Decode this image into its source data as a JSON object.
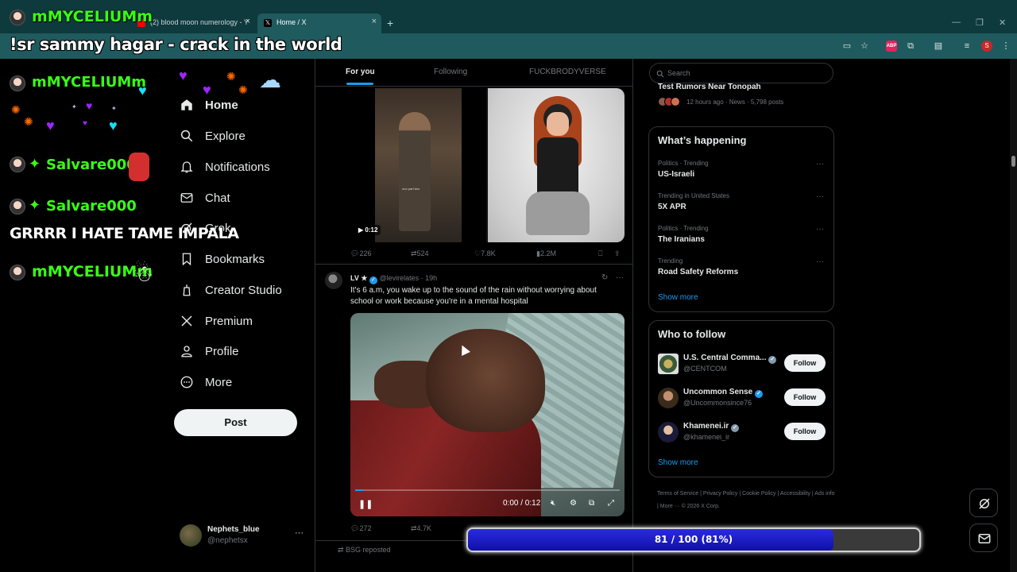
{
  "browser": {
    "tabs": [
      {
        "label": "(2) blood moon numerology - Y",
        "active": false
      },
      {
        "label": "Home / X",
        "active": true
      }
    ],
    "new_tab": "+",
    "tab_close": "×",
    "window": {
      "minimize": "—",
      "restore": "❐",
      "close": "✕"
    },
    "extensions": [
      "cast-icon",
      "star-icon",
      "abp-icon",
      "puzzle-icon",
      "sidebar-icon",
      "media-icon",
      "profile-icon",
      "menu-icon"
    ],
    "ext_abp_label": "ABP",
    "profile_initial": "S"
  },
  "overlay": {
    "song": "!sr sammy hagar - crack in the world",
    "names": [
      "mMYCELIUMm",
      "mMYCELIUMm",
      "Salvare000",
      "Salvare000",
      "mMYCELIUMm"
    ],
    "shout": "GRRRR I HATE TAME IMPALA",
    "progress": {
      "text": "81 / 100 (81%)",
      "value": 0.81
    }
  },
  "nav": {
    "items": [
      {
        "label": "Home",
        "icon": "home-icon"
      },
      {
        "label": "Explore",
        "icon": "search-icon"
      },
      {
        "label": "Notifications",
        "icon": "bell-icon"
      },
      {
        "label": "Chat",
        "icon": "mail-icon"
      },
      {
        "label": "Grok",
        "icon": "grok-icon"
      },
      {
        "label": "Bookmarks",
        "icon": "bookmark-icon"
      },
      {
        "label": "Creator Studio",
        "icon": "creator-studio-icon"
      },
      {
        "label": "Premium",
        "icon": "x-logo-icon"
      },
      {
        "label": "Profile",
        "icon": "person-icon"
      },
      {
        "label": "More",
        "icon": "more-circle-icon"
      }
    ],
    "post_label": "Post",
    "account": {
      "name": "Nephets_blue",
      "handle": "@nephetsx",
      "more": "···"
    }
  },
  "timeline": {
    "tabs": [
      "For you",
      "Following",
      "FUCKBRODYVERSE"
    ],
    "tweet1": {
      "video_duration": "0:12",
      "caption_in_video": "ooo part two",
      "replies": "226",
      "reposts": "524",
      "likes": "7.8K",
      "views": "2.2M"
    },
    "tweet2": {
      "name": "LV ★",
      "handle": "@levirelates",
      "time": "· 19h",
      "text": "It's 6 a.m, you wake up to the sound of the rain without worrying about school or work because you're in a mental hospital",
      "time_display": "0:00 / 0:12",
      "played_fraction": 0.03,
      "replies": "272",
      "reposts": "4.7K"
    },
    "repost_line": "BSG reposted"
  },
  "sidebar": {
    "search_placeholder": "Search",
    "news_top": {
      "title": "Test Rumors Near Tonopah",
      "meta": "12 hours ago · News · 5,798 posts"
    },
    "happening": {
      "title": "What’s happening",
      "trends": [
        {
          "category": "Politics · Trending",
          "name": "US-Israeli"
        },
        {
          "category": "Trending in United States",
          "name": "5X APR"
        },
        {
          "category": "Politics · Trending",
          "name": "The Iranians"
        },
        {
          "category": "Trending",
          "name": "Road Safety Reforms"
        }
      ],
      "show_more": "Show more"
    },
    "who_to_follow": {
      "title": "Who to follow",
      "accounts": [
        {
          "name": "U.S. Central Comma...",
          "handle": "@CENTCOM",
          "badge": "grey"
        },
        {
          "name": "Uncommon Sense",
          "handle": "@Uncommonsince76",
          "badge": "blue"
        },
        {
          "name": "Khamenei.ir",
          "handle": "@khamenei_ir",
          "badge": "grey"
        }
      ],
      "follow_label": "Follow",
      "show_more": "Show more"
    },
    "footer": "Terms of Service  |  Privacy Policy  |  Cookie Policy  |  Accessibility  |  Ads info  |  More ···  © 2026 X Corp."
  },
  "colors": {
    "accent": "#1d9bf0",
    "overlay_green": "#39ff14",
    "progress_fill": "#1a1ad0",
    "browser_teal": "#1f5a5e"
  }
}
